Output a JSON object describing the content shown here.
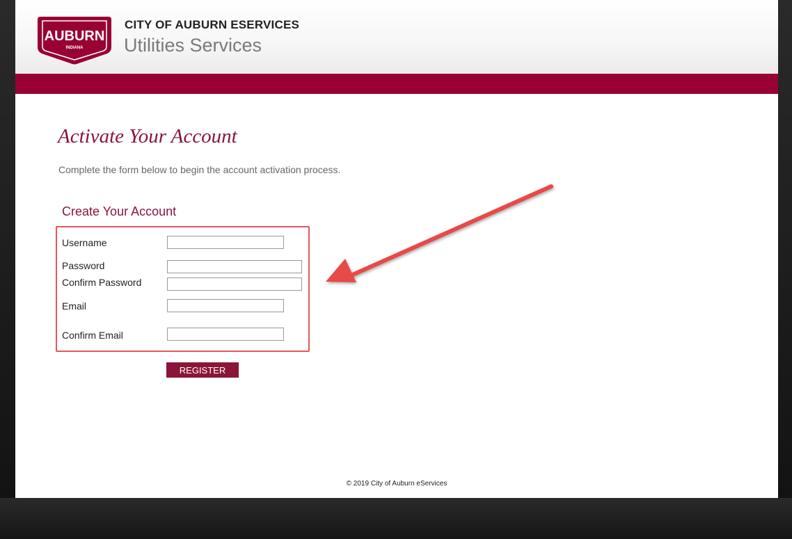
{
  "header": {
    "logo_text": "AUBURN",
    "logo_subtext": "INDIANA",
    "site_title": "CITY OF AUBURN ESERVICES",
    "site_subtitle": "Utilities Services"
  },
  "main": {
    "page_title": "Activate Your Account",
    "intro_text": "Complete the form below to begin the account activation process.",
    "section_title": "Create Your Account",
    "fields": [
      {
        "label": "Username",
        "value": "",
        "placeholder": ""
      },
      {
        "label": "Password",
        "value": "",
        "placeholder": ""
      },
      {
        "label": "Confirm Password",
        "value": "",
        "placeholder": ""
      },
      {
        "label": "Email",
        "value": "",
        "placeholder": ""
      },
      {
        "label": "Confirm Email",
        "value": "",
        "placeholder": ""
      }
    ],
    "register_label": "REGISTER"
  },
  "footer": {
    "copyright": "© 2019 City of Auburn eServices"
  },
  "colors": {
    "brand": "#990033",
    "title_color": "#8a1538",
    "annotation": "#e85555"
  },
  "icons": {
    "annotation_arrow": "arrow-icon"
  }
}
